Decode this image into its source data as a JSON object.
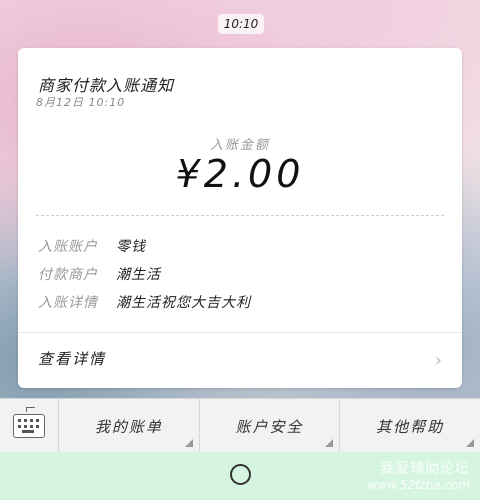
{
  "status_bar": {
    "time": "10:10"
  },
  "notification": {
    "title": "商家付款入账通知",
    "date": "8月12日  10:10",
    "amount_label": "入账金额",
    "amount": "¥2.00",
    "rows": [
      {
        "key": "入账账户",
        "value": "零钱"
      },
      {
        "key": "付款商户",
        "value": "潮生活"
      },
      {
        "key": "入账详情",
        "value": "潮生活祝您大吉大利"
      }
    ],
    "details_label": "查看详情"
  },
  "bottom_menu": {
    "keyboard_icon": "keyboard-icon",
    "items": [
      {
        "label": "我的账单"
      },
      {
        "label": "账户安全"
      },
      {
        "label": "其他帮助"
      }
    ]
  },
  "watermark": {
    "line1": "我爱辅助论坛",
    "line2": "www.52fzba.com"
  },
  "colors": {
    "card_bg": "#ffffff",
    "bottom_bar_bg": "#f2f2f2",
    "nav_bar_bg": "#d6f5e1"
  }
}
